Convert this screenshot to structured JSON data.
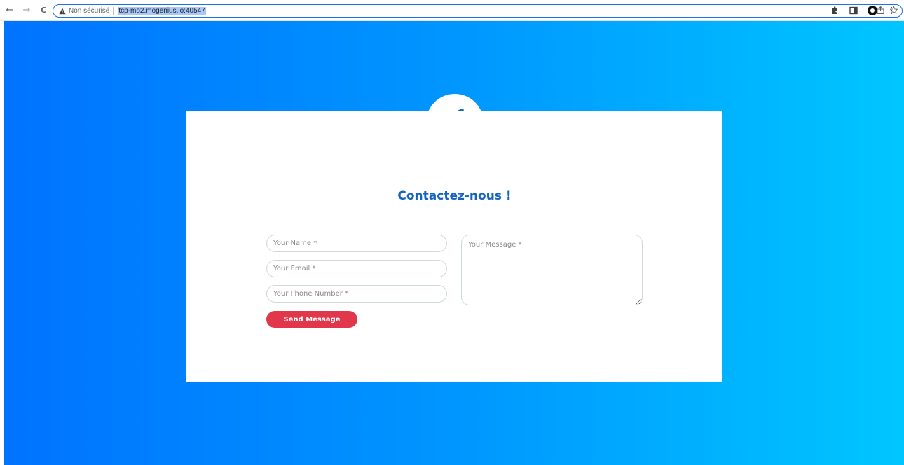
{
  "browser": {
    "security_label": "Non sécurisé",
    "url": "tcp-mo2.mogenius.io:40547",
    "back_glyph": "←",
    "forward_glyph": "→",
    "reload_glyph": "C"
  },
  "page": {
    "title": "Contactez-nous !",
    "form": {
      "name_placeholder": "Your Name *",
      "email_placeholder": "Your Email *",
      "phone_placeholder": "Your Phone Number *",
      "message_placeholder": "Your Message *",
      "submit_label": "Send Message"
    }
  },
  "colors": {
    "gradient_start": "#0073ff",
    "gradient_end": "#00c6ff",
    "title": "#1565c0",
    "rocket": "#1565c0",
    "button": "#e0374b"
  },
  "icons": [
    "back-arrow-icon",
    "forward-arrow-icon",
    "reload-icon",
    "warning-icon",
    "share-icon",
    "star-icon",
    "extensions-icon",
    "sidepanel-icon",
    "profile-avatar-icon",
    "menu-kebab-icon",
    "rocket-icon"
  ]
}
